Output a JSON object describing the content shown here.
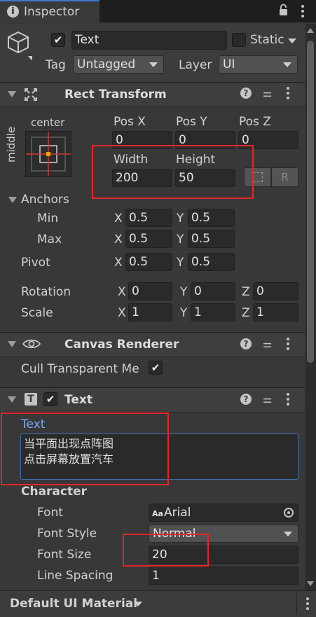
{
  "tab": {
    "title": "Inspector"
  },
  "object": {
    "name": "Text",
    "active": true,
    "static_label": "Static",
    "tag_label": "Tag",
    "tag_value": "Untagged",
    "layer_label": "Layer",
    "layer_value": "UI"
  },
  "rect_transform": {
    "title": "Rect Transform",
    "anchor_preset_h": "center",
    "anchor_preset_v": "middle",
    "pos_x_label": "Pos X",
    "pos_y_label": "Pos Y",
    "pos_z_label": "Pos Z",
    "pos_x": "0",
    "pos_y": "0",
    "pos_z": "0",
    "width_label": "Width",
    "height_label": "Height",
    "width": "200",
    "height": "50",
    "r_button": "R",
    "anchors_label": "Anchors",
    "min_label": "Min",
    "min_x": "0.5",
    "min_y": "0.5",
    "max_label": "Max",
    "max_x": "0.5",
    "max_y": "0.5",
    "pivot_label": "Pivot",
    "pivot_x": "0.5",
    "pivot_y": "0.5",
    "rotation_label": "Rotation",
    "rot_x": "0",
    "rot_y": "0",
    "rot_z": "0",
    "scale_label": "Scale",
    "scale_x": "1",
    "scale_y": "1",
    "scale_z": "1",
    "x": "X",
    "y": "Y",
    "z": "Z"
  },
  "canvas_renderer": {
    "title": "Canvas Renderer",
    "cull_label": "Cull Transparent Me",
    "cull_checked": true
  },
  "text_component": {
    "title": "Text",
    "text_label": "Text",
    "text_line1": "当平面出现点阵图",
    "text_line2": "点击屏幕放置汽车",
    "character_label": "Character",
    "font_label": "Font",
    "font_value": "Arial",
    "font_icon_text": "Aa",
    "font_style_label": "Font Style",
    "font_style_value": "Normal",
    "font_size_label": "Font Size",
    "font_size_value": "20",
    "line_spacing_label": "Line Spacing",
    "line_spacing_value": "1"
  },
  "footer": {
    "material": "Default UI Material"
  },
  "colors": {
    "highlight": "#e3262a",
    "link_blue": "#7ea7ef",
    "accent": "#f4a300"
  }
}
